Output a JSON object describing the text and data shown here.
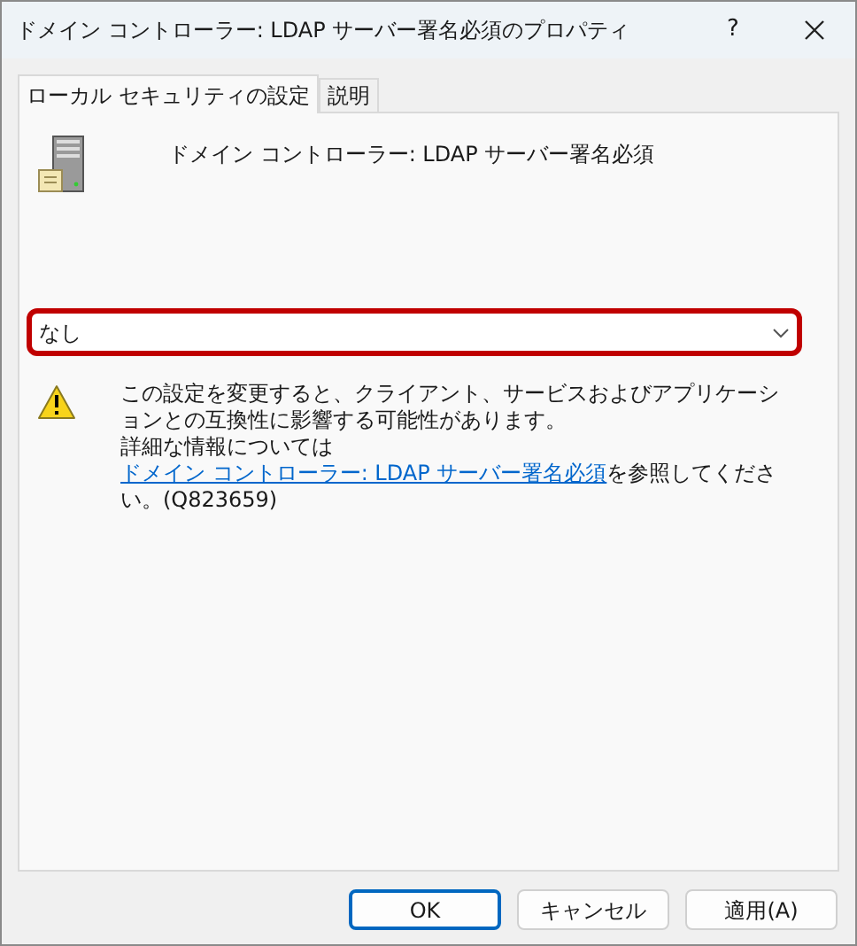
{
  "window": {
    "title": "ドメイン コントローラー: LDAP サーバー署名必須のプロパティ",
    "help": "?"
  },
  "tabs": [
    {
      "label": "ローカル セキュリティの設定",
      "selected": true
    },
    {
      "label": "説明",
      "selected": false
    }
  ],
  "policy": {
    "name": "ドメイン コントローラー: LDAP サーバー署名必須"
  },
  "dropdown": {
    "value": "なし",
    "highlighted": true
  },
  "warning": {
    "text_before": "この設定を変更すると、クライアント、サービスおよびアプリケーションとの互換性に影響する可能性があります。",
    "text_more": "詳細な情報については ",
    "link": "ドメイン コントローラー: LDAP サーバー署名必須",
    "text_after": "を参照してください。(Q823659)"
  },
  "buttons": [
    {
      "label": "OK",
      "default": true
    },
    {
      "label": "キャンセル",
      "default": false
    },
    {
      "label": "適用(A)",
      "default": false
    }
  ]
}
